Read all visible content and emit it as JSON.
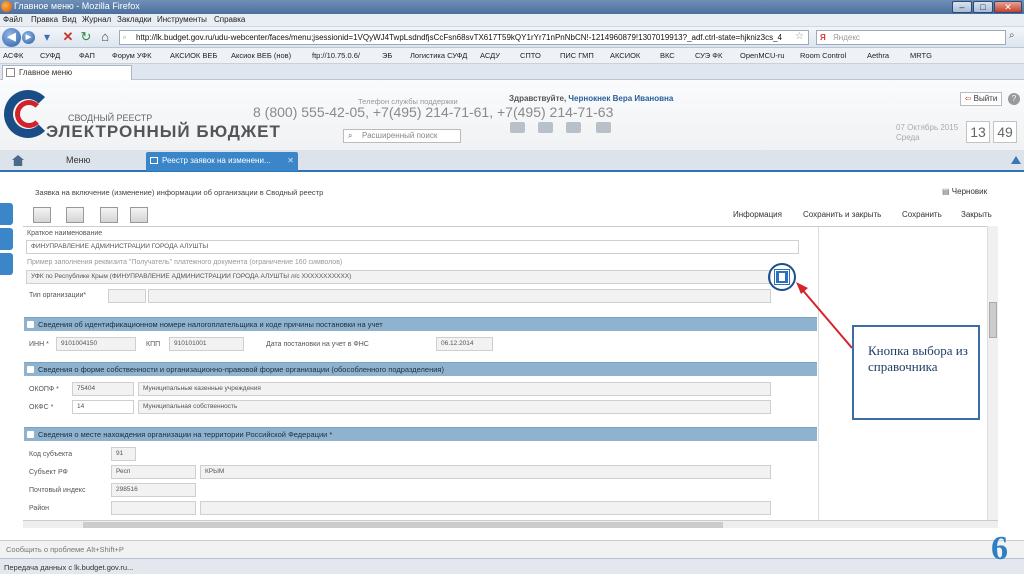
{
  "browser": {
    "title": "Главное меню - Mozilla Firefox",
    "menu": [
      "Файл",
      "Правка",
      "Вид",
      "Журнал",
      "Закладки",
      "Инструменты",
      "Справка"
    ],
    "url": "http://lk.budget.gov.ru/udu-webcenter/faces/menu;jsessionid=1VQyWJ4TwpLsdndfjsCcFsn68svTX617T59kQY1rYr71nPnNbCN!-1214960879!1307019913?_adf.ctrl-state=hjkniz3cs_4",
    "search_placeholder": "Яндекс",
    "bookmarks": [
      "АСФК",
      "СУФД",
      "ФАП",
      "Форум УФК",
      "АКСИОК ВЕБ",
      "Аксиок ВЕБ (нов)",
      "ftp://10.75.0.6/",
      "ЭБ",
      "Логистика СУФД",
      "АСДУ",
      "СПТО",
      "ПИС ГМП",
      "АКСИОК",
      "ВКС",
      "СУЭ ФК",
      "OpenMCU-ru",
      "Room Control",
      "Aethra",
      "MRTG"
    ],
    "tab_label": "Главное меню",
    "status": "Передача данных с lk.budget.gov.ru..."
  },
  "header": {
    "logo_small": "СВОДНЫЙ РЕЕСТР",
    "logo_big": "ЭЛЕКТРОННЫЙ БЮДЖЕТ",
    "phone_label": "Телефон службы поддержки",
    "phones": "8 (800) 555-42-05, +7(495) 214-71-61, +7(495) 214-71-63",
    "search_placeholder": "Расширенный поиск",
    "greeting": "Здравствуйте,",
    "user_name": "Чернокнек Вера Ивановна",
    "exit_label": "Выйти",
    "help": "?",
    "date": "07 Октябрь 2015",
    "weekday": "Среда",
    "hour": "13",
    "minute": "49"
  },
  "nav": {
    "menu_label": "Меню",
    "active_tab": "Реестр заявок на изменени..."
  },
  "form": {
    "title": "Заявка на включение (изменение) информации об организации в Сводный реестр",
    "draft": "Черновик",
    "actions": [
      "Информация",
      "Сохранить и закрыть",
      "Сохранить",
      "Закрыть"
    ],
    "short_name_label": "Краткое наименование",
    "short_name_value": "ФИНУПРАВЛЕНИЕ АДМИНИСТРАЦИИ ГОРОДА АЛУШТЫ",
    "payee_hint": "Пример заполнения реквизита \"Получатель\" платежного документа (ограничение 160 символов)",
    "payee_value": "УФК по Республике Крым (ФИНУПРАВЛЕНИЕ АДМИНИСТРАЦИИ ГОРОДА АЛУШТЫ л/с XXXXXXXXXXX)",
    "org_type_label": "Тип организации*",
    "section1": "Сведения об идентификационном номере налогоплательщика и коде причины постановки на учет",
    "inn_label": "ИНН *",
    "inn_value": "9101004150",
    "kpp_label": "КПП",
    "kpp_value": "910101001",
    "reg_date_label": "Дата постановки на учет в ФНС",
    "reg_date_value": "06.12.2014",
    "section2": "Сведения о форме собственности и организационно-правовой форме организации (обособленного подразделения)",
    "okopf_label": "ОКОПФ *",
    "okopf_code": "75404",
    "okopf_name": "Муниципальные казенные учреждения",
    "okfs_label": "ОКФС *",
    "okfs_code": "14",
    "okfs_name": "Муниципальная собственность",
    "section3": "Сведения о месте нахождения организации на территории Российской Федерации *",
    "subject_code_label": "Код субъекта",
    "subject_code_value": "91",
    "subject_label": "Субъект РФ",
    "subject_short": "Респ",
    "subject_name": "КРЫМ",
    "postcode_label": "Почтовый индекс",
    "postcode_value": "298516",
    "district_label": "Район"
  },
  "callout": {
    "text": "Кнопка выбора из справочника"
  },
  "footer": {
    "report": "Сообщить о проблеме Alt+Shift+P"
  },
  "slide_number": "6"
}
